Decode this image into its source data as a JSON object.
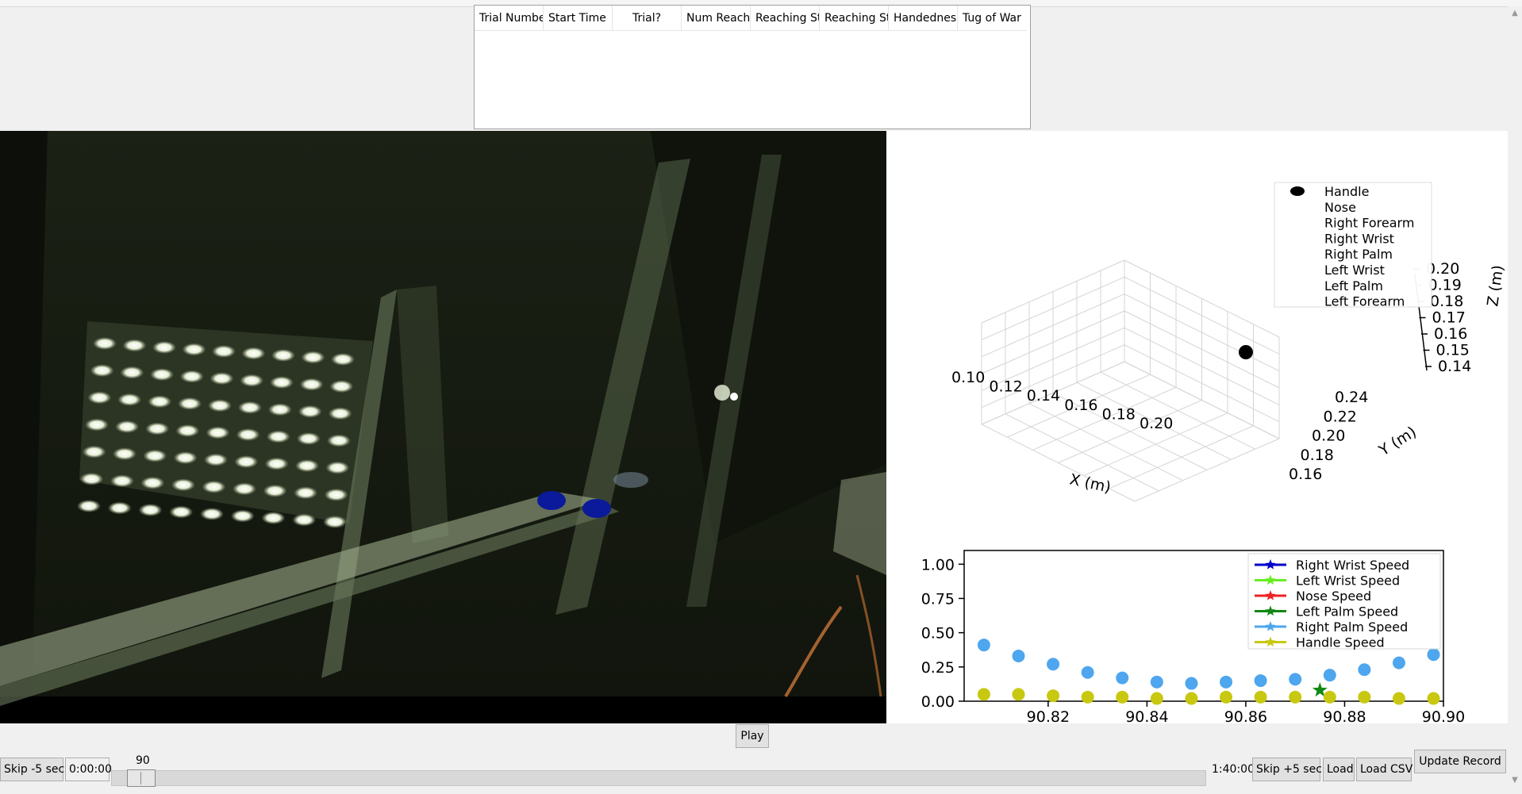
{
  "trial_table": {
    "columns": [
      "Trial Numbe",
      "Start Time",
      "Trial?",
      "Num Reach",
      "Reaching St",
      "Reaching St",
      "Handednes:",
      "Tug of War"
    ]
  },
  "plot3d": {
    "legend": [
      "Handle",
      "Nose",
      "Right Forearm",
      "Right Wrist",
      "Right Palm",
      "Left Wrist",
      "Left Palm",
      "Left Forearm"
    ],
    "x_ticks": [
      "0.10",
      "0.12",
      "0.14",
      "0.16",
      "0.18",
      "0.20"
    ],
    "y_ticks": [
      "0.16",
      "0.18",
      "0.20",
      "0.22",
      "0.24"
    ],
    "z_ticks": [
      "0.14",
      "0.15",
      "0.16",
      "0.17",
      "0.18",
      "0.19",
      "0.20"
    ],
    "xlabel": "X (m)",
    "ylabel": "Y (m)",
    "zlabel": "Z (m)"
  },
  "chart_data": {
    "type": "scatter",
    "x": [
      90.807,
      90.814,
      90.821,
      90.828,
      90.835,
      90.842,
      90.849,
      90.856,
      90.863,
      90.87,
      90.877,
      90.884,
      90.891,
      90.898
    ],
    "series": [
      {
        "name": "Right Wrist Speed",
        "color": "#0000cc",
        "values": []
      },
      {
        "name": "Left Wrist Speed",
        "color": "#66ee22",
        "values": []
      },
      {
        "name": "Nose Speed",
        "color": "#ee2222",
        "values": []
      },
      {
        "name": "Left Palm Speed",
        "color": "#118811",
        "points": [
          [
            90.875,
            0.08
          ]
        ]
      },
      {
        "name": "Right Palm Speed",
        "color": "#4ea6ee",
        "values": [
          0.41,
          0.33,
          0.27,
          0.21,
          0.17,
          0.14,
          0.13,
          0.14,
          0.15,
          0.16,
          0.19,
          0.23,
          0.28,
          0.34
        ]
      },
      {
        "name": "Handle Speed",
        "color": "#c8c811",
        "values": [
          0.05,
          0.05,
          0.04,
          0.03,
          0.03,
          0.02,
          0.02,
          0.03,
          0.03,
          0.03,
          0.03,
          0.03,
          0.02,
          0.02
        ]
      }
    ],
    "x_ticks": [
      "90.82",
      "90.84",
      "90.86",
      "90.88",
      "90.90"
    ],
    "y_ticks": [
      "0.00",
      "0.25",
      "0.50",
      "0.75",
      "1.00"
    ],
    "xlim": [
      90.803,
      90.9
    ],
    "ylim": [
      0,
      1.1
    ],
    "legend_position": "top-right"
  },
  "controls": {
    "play": "Play",
    "skip_back": "Skip -5 sec",
    "current_time": "0:00:00",
    "slider_value": "90",
    "end_time": "1:40:00",
    "skip_forward": "Skip +5 sec",
    "load": "Load",
    "load_csv": "Load CSV",
    "update_record": "Update Record"
  },
  "icons": {
    "scroll_up": "▲",
    "scroll_down": "▼"
  }
}
